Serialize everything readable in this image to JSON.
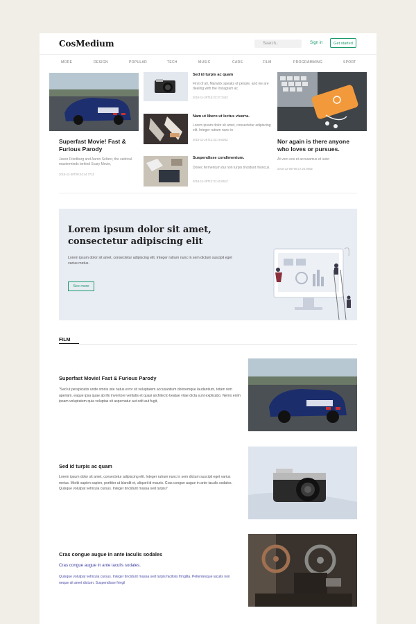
{
  "header": {
    "logo": "CosMedium",
    "search_placeholder": "Search..",
    "sign_in": "Sign in",
    "get_started": "Get started"
  },
  "nav": [
    "MORE",
    "DESIGN",
    "POPULAR",
    "TECH",
    "MUSIC",
    "CARS",
    "FILM",
    "PROGRAMMING",
    "SPORT"
  ],
  "featured_left": {
    "title": "Superfast Movie! Fast & Furious Parody",
    "excerpt": "Jason Friedburg and Aaron Seltzer, the satirical masterminds behind Scary Movie,",
    "date": "2016-12-30T09:24:44.771Z"
  },
  "featured_middle": [
    {
      "title": "Sed id turpis ac quam",
      "excerpt": "First of all, Marwick speaks of people, and we are dealing with the Instagram ac",
      "date": "2016-11-28T16:23:37.244Z"
    },
    {
      "title": "Nam ut libero ut lectus viverra.",
      "excerpt": "Lorem ipsum dolor sit amet, consectetur adipiscing elit. Integer rutrum nunc in",
      "date": "2016-11-28T12:33:19.826Z"
    },
    {
      "title": "Suspendisse condimentum.",
      "excerpt": "Donec fermentum dui non turpis tincidunt rhoncus.",
      "date": "2016-11-28T12:31:40.061Z"
    }
  ],
  "featured_right": {
    "title": "Nor again is there anyone who loves or pursues.",
    "excerpt": "At vero eos et accusamus et iusto",
    "date": "2016-12-05T08:17:24.906Z"
  },
  "hero": {
    "title": "Lorem ipsum dolor sit amet, consectetur adipiscing elit",
    "text": "Lorem ipsum dolor sit amet, consectetur adipiscing elit. Integer rutrum nunc in sem dictum suscipit eget varius metus.",
    "button": "See more"
  },
  "film": {
    "label": "FILM",
    "posts": [
      {
        "title": "Superfast Movie! Fast & Furious Parody",
        "subtitle": "",
        "text": "\"Sed ut perspiciatis unde omnis iste natus error sit voluptatem accusantium doloremque laudantium, totam rem aperiam, eaque ipsa quae ab illo inventore veritatis et quasi architecto beatae vitae dicta sunt explicabo. Nemo enim ipsam voluptatem quia voluptas sit aspernatur aut odit aut fugit,"
      },
      {
        "title": "Sed id turpis ac quam",
        "subtitle": "",
        "text": "Lorem ipsum dolor sit amet, consectetur adipiscing elit. Integer rutrum nunc in sem dictum suscipit eget varius metus. Morbi sapien sapien, porttitor ut blandit et, aliquet id mauris. Cras congue augue in ante iaculis sodales. Quisque volutpat vehicula cursus. Integer tincidunt massa sed turpis f"
      },
      {
        "title": "Cras congue augue in ante iaculis sodales",
        "subtitle": "Cras congue augue in ante iaculis sodales.",
        "text": "Quisque volutpat vehicula cursus. Integer tincidunt massa sed turpis facilisis fringilla. Pellentesque iaculis non neque sit amet dictum. Suspendisse fringil"
      }
    ]
  },
  "colors": {
    "accent": "#1c9a6c",
    "hero_bg": "#e8ecf3",
    "page_bg": "#f1eee8"
  }
}
